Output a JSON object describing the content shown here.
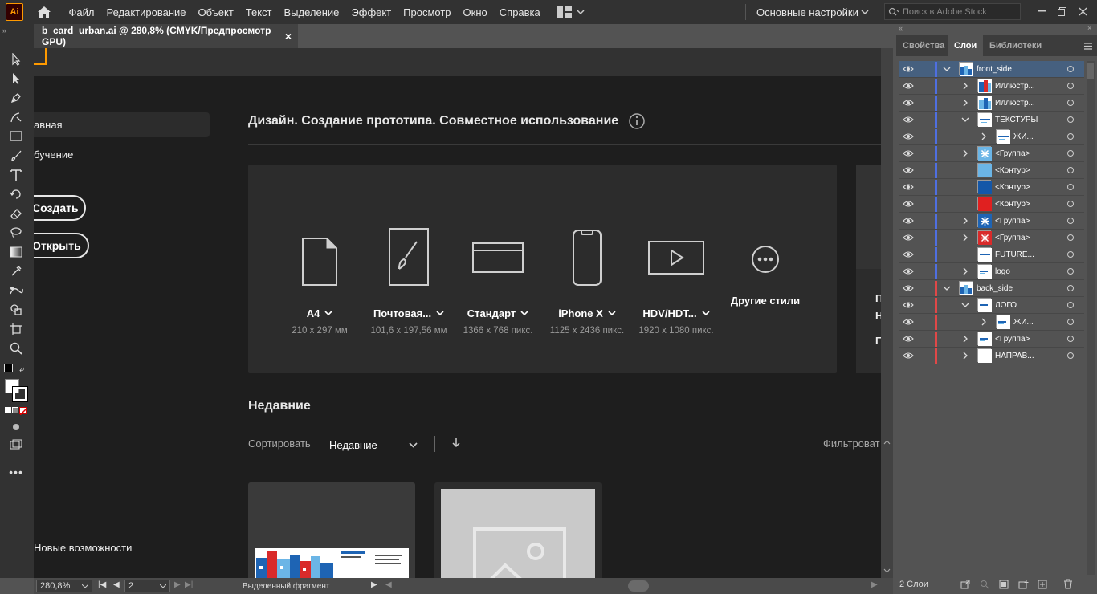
{
  "app": {
    "logo": "Ai"
  },
  "menu": [
    "Файл",
    "Редактирование",
    "Объект",
    "Текст",
    "Выделение",
    "Эффект",
    "Просмотр",
    "Окно",
    "Справка"
  ],
  "workspace": {
    "name": "Основные настройки"
  },
  "stock_search": {
    "placeholder": "Поиск в Adobe Stock"
  },
  "document_tab": {
    "title": "b_card_urban.ai @ 280,8% (CMYK/Предпросмотр GPU)",
    "close": "×"
  },
  "home": {
    "nav": {
      "home": "авная",
      "learn": "бучение",
      "create": "Создать",
      "open": "Открыть",
      "whats_new": "Новые возможности"
    },
    "title": "Дизайн. Создание прототипа. Совместное использование",
    "presets": [
      {
        "name": "A4",
        "dims": "210 x 297 мм",
        "icon": "document-icon"
      },
      {
        "name": "Почтовая...",
        "dims": "101,6 x 197,56 мм",
        "icon": "brush-icon"
      },
      {
        "name": "Стандарт",
        "dims": "1366 x 768 пикс.",
        "icon": "browser-icon"
      },
      {
        "name": "iPhone X",
        "dims": "1125 x 2436 пикс.",
        "icon": "phone-icon"
      },
      {
        "name": "HDV/HDT...",
        "dims": "1920 x 1080 пикс.",
        "icon": "video-icon"
      },
      {
        "name": "Другие стили",
        "dims": "",
        "icon": "more-icon"
      }
    ],
    "right_card_letters": [
      "П",
      "Н",
      "Г"
    ],
    "recent": {
      "title": "Недавние",
      "sort_label": "Сортировать",
      "sort_value": "Недавние",
      "filter_label": "Фильтроват"
    }
  },
  "status": {
    "zoom": "280,8%",
    "page": "2",
    "tool": "Выделенный фрагмент"
  },
  "panel": {
    "tabs": [
      "Свойства",
      "Слои",
      "Библиотеки"
    ],
    "active_tab": "Слои",
    "layers": [
      {
        "name": "front_side",
        "level": 0,
        "caret": "down",
        "selected": true,
        "color": "#4f6fe0",
        "thumb": "card"
      },
      {
        "name": "Иллюстр...",
        "level": 1,
        "caret": "right",
        "color": "#4f6fe0",
        "thumb": "illus-red"
      },
      {
        "name": "Иллюстр...",
        "level": 1,
        "caret": "right",
        "color": "#4f6fe0",
        "thumb": "illus-blue"
      },
      {
        "name": "ТЕКСТУРЫ",
        "level": 1,
        "caret": "down",
        "color": "#4f6fe0",
        "thumb": "texture"
      },
      {
        "name": "ЖИ...",
        "level": 2,
        "caret": "right",
        "color": "#4f6fe0",
        "thumb": "texture"
      },
      {
        "name": "<Группа>",
        "level": 1,
        "caret": "right",
        "color": "#4f6fe0",
        "thumb": "snow-light"
      },
      {
        "name": "<Контур>",
        "level": 1,
        "caret": "none",
        "color": "#4f6fe0",
        "thumb": "light-blue"
      },
      {
        "name": "<Контур>",
        "level": 1,
        "caret": "none",
        "color": "#4f6fe0",
        "thumb": "dark-blue"
      },
      {
        "name": "<Контур>",
        "level": 1,
        "caret": "none",
        "color": "#4f6fe0",
        "thumb": "red"
      },
      {
        "name": "<Группа>",
        "level": 1,
        "caret": "right",
        "color": "#4f6fe0",
        "thumb": "snow-blue"
      },
      {
        "name": "<Группа>",
        "level": 1,
        "caret": "right",
        "color": "#4f6fe0",
        "thumb": "snow-red"
      },
      {
        "name": "FUTURE...",
        "level": 1,
        "caret": "none",
        "color": "#4f6fe0",
        "thumb": "line"
      },
      {
        "name": "logo",
        "level": 1,
        "caret": "right",
        "color": "#4f6fe0",
        "thumb": "logo"
      },
      {
        "name": "back_side",
        "level": 0,
        "caret": "down",
        "color": "#e04848",
        "thumb": "card"
      },
      {
        "name": "ЛОГО",
        "level": 1,
        "caret": "down",
        "color": "#e04848",
        "thumb": "logo"
      },
      {
        "name": "ЖИ...",
        "level": 2,
        "caret": "right",
        "color": "#e04848",
        "thumb": "logo"
      },
      {
        "name": "<Группа>",
        "level": 1,
        "caret": "right",
        "color": "#e04848",
        "thumb": "logo"
      },
      {
        "name": "НАПРАВ...",
        "level": 1,
        "caret": "right",
        "color": "#e04848",
        "thumb": "blank"
      }
    ],
    "layer_count": "2 Слои"
  }
}
